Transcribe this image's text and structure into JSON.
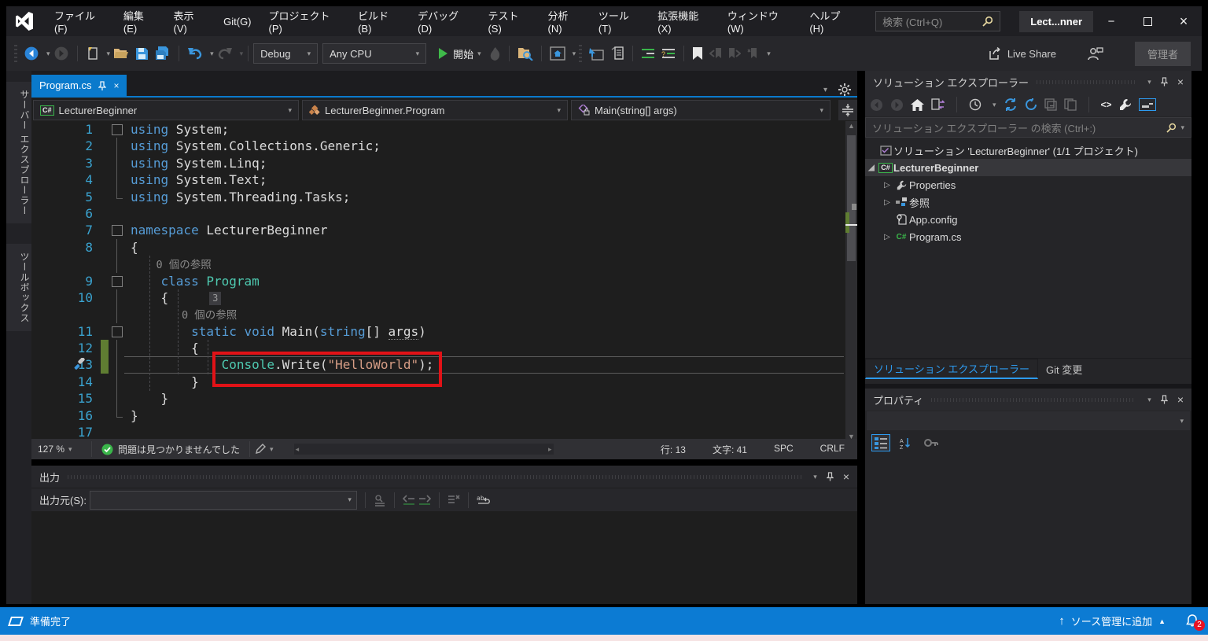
{
  "window": {
    "title_chip": "Lect...nner",
    "search_placeholder": "検索 (Ctrl+Q)",
    "live_share_label": "Live Share",
    "admin_label": "管理者"
  },
  "menubar": {
    "items": [
      "ファイル(F)",
      "編集(E)",
      "表示(V)",
      "Git(G)",
      "プロジェクト(P)",
      "ビルド(B)",
      "デバッグ(D)",
      "テスト(S)",
      "分析(N)",
      "ツール(T)",
      "拡張機能(X)",
      "ウィンドウ(W)",
      "ヘルプ(H)"
    ]
  },
  "toolbar": {
    "config": "Debug",
    "platform": "Any CPU",
    "start_label": "開始"
  },
  "left_tabs": {
    "items": [
      "サーバー エクスプローラー",
      "ツールボックス"
    ]
  },
  "editor": {
    "tab": "Program.cs",
    "nav": {
      "project": "LecturerBeginner",
      "type": "LecturerBeginner.Program",
      "member": "Main(string[] args)"
    },
    "code": {
      "lines": [
        {
          "n": "1",
          "fold": true,
          "tokens": [
            [
              "k",
              "using"
            ],
            [
              "d",
              " System;"
            ]
          ]
        },
        {
          "n": "2",
          "g": "|",
          "tokens": [
            [
              "k",
              "using"
            ],
            [
              "d",
              " System.Collections.Generic;"
            ]
          ]
        },
        {
          "n": "3",
          "g": "|",
          "tokens": [
            [
              "k",
              "using"
            ],
            [
              "d",
              " System.Linq;"
            ]
          ]
        },
        {
          "n": "4",
          "g": "|",
          "tokens": [
            [
              "k",
              "using"
            ],
            [
              "d",
              " System.Text;"
            ]
          ]
        },
        {
          "n": "5",
          "g": "L",
          "tokens": [
            [
              "k",
              "using"
            ],
            [
              "d",
              " System.Threading.Tasks;"
            ]
          ]
        },
        {
          "n": "6",
          "tokens": []
        },
        {
          "n": "7",
          "fold": true,
          "tokens": [
            [
              "k",
              "namespace"
            ],
            [
              "d",
              " LecturerBeginner"
            ]
          ]
        },
        {
          "n": "8",
          "g": "|",
          "tokens": [
            [
              "d",
              "{"
            ]
          ]
        },
        {
          "n": "",
          "g": "|",
          "tokens": [
            [
              "l",
              "    0 個の参照"
            ]
          ]
        },
        {
          "n": "9",
          "fold": true,
          "tokens": [
            [
              "d",
              "    "
            ],
            [
              "k",
              "class"
            ],
            [
              "t",
              " Program"
            ]
          ]
        },
        {
          "n": "10",
          "g": "|",
          "badge": "3",
          "tokens": [
            [
              "d",
              "    {"
            ]
          ]
        },
        {
          "n": "",
          "g": "|",
          "tokens": [
            [
              "l",
              "        0 個の参照"
            ]
          ]
        },
        {
          "n": "11",
          "fold": true,
          "tokens": [
            [
              "d",
              "        "
            ],
            [
              "k",
              "static"
            ],
            [
              "d",
              " "
            ],
            [
              "k",
              "void"
            ],
            [
              "d",
              " "
            ],
            [
              "m",
              "Main"
            ],
            [
              "d",
              "("
            ],
            [
              "k",
              "string"
            ],
            [
              "d",
              "[] "
            ],
            [
              "a",
              "args"
            ],
            [
              "d",
              ")"
            ]
          ]
        },
        {
          "n": "12",
          "g": "|",
          "chg": true,
          "tokens": [
            [
              "d",
              "        {"
            ]
          ]
        },
        {
          "n": "13",
          "g": "|",
          "chg": true,
          "cur": true,
          "tokens": [
            [
              "d",
              "            "
            ],
            [
              "t",
              "Console"
            ],
            [
              "d",
              "."
            ],
            [
              "m",
              "Write"
            ],
            [
              "d",
              "("
            ],
            [
              "s",
              "\"HelloWorld\""
            ],
            [
              "d",
              ");"
            ]
          ]
        },
        {
          "n": "14",
          "g": "|",
          "tokens": [
            [
              "d",
              "        }"
            ]
          ]
        },
        {
          "n": "15",
          "g": "|",
          "tokens": [
            [
              "d",
              "    }"
            ]
          ]
        },
        {
          "n": "16",
          "g": "L",
          "tokens": [
            [
              "d",
              "}"
            ]
          ]
        },
        {
          "n": "17",
          "tokens": []
        }
      ]
    },
    "status": {
      "zoom": "127 %",
      "problems": "問題は見つかりませんでした",
      "line": "行: 13",
      "column": "文字: 41",
      "spaces": "SPC",
      "eol": "CRLF"
    }
  },
  "output": {
    "title": "出力",
    "source_label": "出力元(S):",
    "source_value": ""
  },
  "solution_explorer": {
    "title": "ソリューション エクスプローラー",
    "search_placeholder": "ソリューション エクスプローラー の検索 (Ctrl+:)",
    "tree": [
      {
        "label": "ソリューション 'LecturerBeginner' (1/1 プロジェクト)"
      },
      {
        "label": "LecturerBeginner"
      },
      {
        "label": "Properties"
      },
      {
        "label": "参照"
      },
      {
        "label": "App.config"
      },
      {
        "label": "Program.cs"
      }
    ],
    "tabs": [
      "ソリューション エクスプローラー",
      "Git 変更"
    ]
  },
  "properties_panel": {
    "title": "プロパティ"
  },
  "statusbar": {
    "ready": "準備完了",
    "add_to_source_control": "ソース管理に追加",
    "notification_count": "2"
  },
  "colors": {
    "accent": "#007acc",
    "statusbar_blue": "#0c7bd3",
    "annotation_red": "#e11217",
    "keyword": "#569cd6",
    "type": "#4ec9b0",
    "string": "#d69d85",
    "line_number": "#3aa3d0",
    "change_bar": "#5f7d32"
  }
}
